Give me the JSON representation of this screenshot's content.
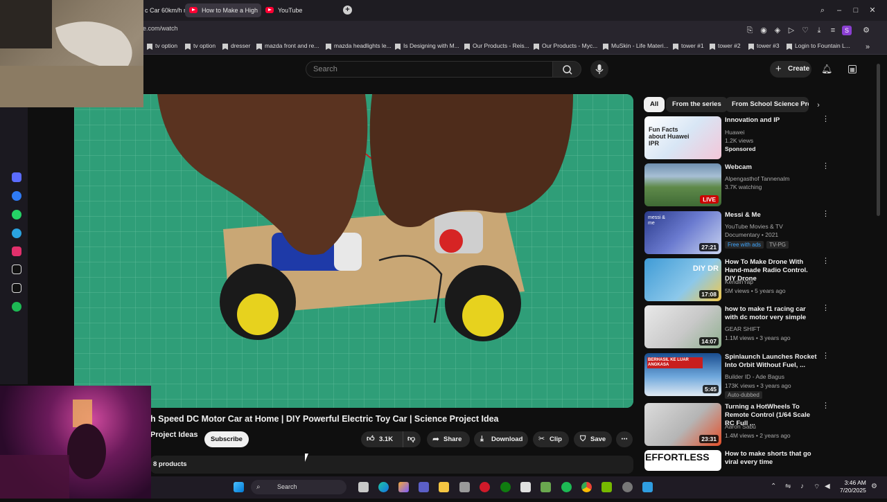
{
  "browser": {
    "tabs": [
      {
        "label": "c Car 60km/h m"
      },
      {
        "label": "How to Make a High"
      },
      {
        "label": "YouTube"
      }
    ],
    "new_tab": "+",
    "url": "e.com/watch",
    "bookmarks": [
      "tv option",
      "tv option",
      "dresser",
      "mazda front and re...",
      "mazda headlights le...",
      "Is Designing with M...",
      "Our Products - Reis...",
      "Our Products - Myc...",
      "MuSkin - Life Materi...",
      "tower #1",
      "tower #2",
      "tower #3",
      "Login to Fountain L..."
    ],
    "profile_letter": "S"
  },
  "header": {
    "search_placeholder": "Search",
    "create_label": "Create"
  },
  "video": {
    "title": "h Speed DC Motor Car at Home | DIY Powerful Electric Toy Car | Science Project Idea",
    "channel": "Project Ideas",
    "subscribe_label": "Subscribe",
    "likes": "3.1K",
    "share_label": "Share",
    "download_label": "Download",
    "clip_label": "Clip",
    "save_label": "Save",
    "products_label": "8 products"
  },
  "chips": [
    "All",
    "From the series",
    "From School Science Pro"
  ],
  "recommendations": [
    {
      "title": "Innovation and IP",
      "line1": "Huawei",
      "line2": "1.2K views",
      "line3": "Sponsored",
      "thumb_text": "Fun Facts about Huawei IPR",
      "duration": "",
      "live": ""
    },
    {
      "title": "Webcam",
      "line1": "Alpengasthof Tannenalm",
      "line2": "3.7K watching",
      "line3": "",
      "thumb_text": "",
      "duration": "",
      "live": "LIVE"
    },
    {
      "title": "Messi & Me",
      "line1": "YouTube Movies & TV",
      "line2": "Documentary • 2021",
      "line3": "",
      "badge1": "Free with ads",
      "badge2": "TV-PG",
      "thumb_text": "messi & me",
      "duration": "27:21",
      "live": ""
    },
    {
      "title": "How To Make Drone With Hand-made Radio Control. DIY Drone",
      "line1": "KendinYap",
      "line2": "5M views • 5 years ago",
      "line3": "",
      "thumb_text": "DIY DR",
      "duration": "17:08",
      "live": ""
    },
    {
      "title": "how to make f1 racing car with dc motor very simple",
      "line1": "GEAR SHIFT",
      "line2": "1.1M views • 3 years ago",
      "line3": "",
      "thumb_text": "",
      "duration": "14:07",
      "live": ""
    },
    {
      "title": "Spinlaunch Launches Rocket Into Orbit Without Fuel, ...",
      "line1": "Builder ID - Ade Bagus",
      "line2": "173K views • 3 years ago",
      "line3": "Auto-dubbed",
      "thumb_text": "BERHASIL KE LUAR ANGKASA",
      "duration": "5:45",
      "live": ""
    },
    {
      "title": "Turning a HotWheels To Remote Control (1/64 Scale RC Full ...",
      "line1": "Aaron Sabu",
      "line2": "1.4M views • 2 years ago",
      "line3": "",
      "thumb_text": "",
      "duration": "23:31",
      "live": ""
    },
    {
      "title": "How to make shorts that go viral every time",
      "line1": "",
      "line2": "",
      "line3": "",
      "thumb_text": "EFFORTLESS",
      "duration": "",
      "live": ""
    }
  ],
  "taskbar": {
    "search_label": "Search",
    "time": "3:46 AM",
    "date": "7/20/2025"
  },
  "colors": {
    "accent_red": "#ff0033",
    "background": "#0f0f0f",
    "video_mat": "#2f9e78"
  }
}
